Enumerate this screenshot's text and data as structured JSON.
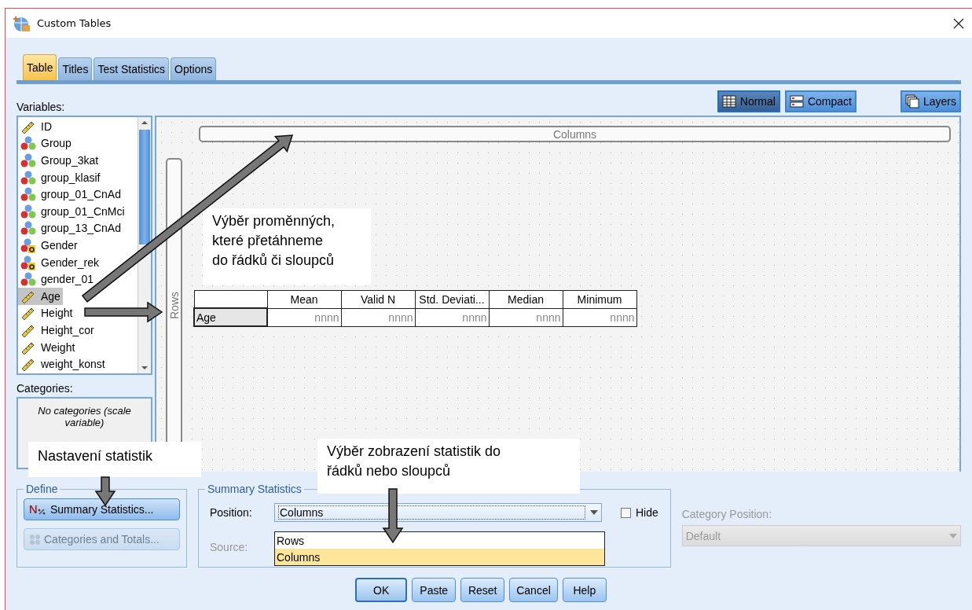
{
  "window": {
    "title": "Custom Tables"
  },
  "tabs": [
    {
      "label": "Table",
      "selected": true
    },
    {
      "label": "Titles",
      "selected": false
    },
    {
      "label": "Test Statistics",
      "selected": false
    },
    {
      "label": "Options",
      "selected": false
    }
  ],
  "variables_label": "Variables:",
  "view_buttons": [
    {
      "label": "Normal",
      "kind": "normal",
      "selected": true
    },
    {
      "label": "Compact",
      "kind": "compact",
      "selected": false
    }
  ],
  "layers_button": "Layers",
  "variables": [
    {
      "name": "ID",
      "kind": "scale",
      "selected": false
    },
    {
      "name": "Group",
      "kind": "nominal",
      "selected": false
    },
    {
      "name": "Group_3kat",
      "kind": "nominal",
      "selected": false
    },
    {
      "name": "group_klasif",
      "kind": "nominal",
      "selected": false
    },
    {
      "name": "group_01_CnAd",
      "kind": "nominal",
      "selected": false
    },
    {
      "name": "group_01_CnMci",
      "kind": "nominal",
      "selected": false
    },
    {
      "name": "group_13_CnAd",
      "kind": "nominal",
      "selected": false
    },
    {
      "name": "Gender",
      "kind": "nominal_string",
      "selected": false
    },
    {
      "name": "Gender_rek",
      "kind": "nominal_string",
      "selected": false
    },
    {
      "name": "gender_01",
      "kind": "nominal",
      "selected": false
    },
    {
      "name": "Age",
      "kind": "scale",
      "selected": true
    },
    {
      "name": "Height",
      "kind": "scale",
      "selected": false
    },
    {
      "name": "Height_cor",
      "kind": "scale",
      "selected": false
    },
    {
      "name": "Weight",
      "kind": "scale",
      "selected": false
    },
    {
      "name": "weight_konst",
      "kind": "scale",
      "selected": false
    }
  ],
  "categories": {
    "label": "Categories:",
    "message": "No categories (scale variable)"
  },
  "canvas": {
    "columns_label": "Columns",
    "rows_label": "Rows",
    "table": {
      "columns": [
        "Mean",
        "Valid N",
        "Std. Deviati...",
        "Median",
        "Minimum"
      ],
      "rows": [
        {
          "label": "Age",
          "cells": [
            "nnnn",
            "nnnn",
            "nnnn",
            "nnnn",
            "nnnn"
          ]
        }
      ]
    }
  },
  "define": {
    "legend": "Define",
    "buttons": [
      {
        "label": "Summary Statistics...",
        "kind": "summary",
        "disabled": false
      },
      {
        "label": "Categories and Totals...",
        "kind": "categories",
        "disabled": true
      }
    ]
  },
  "summary_statistics": {
    "legend": "Summary Statistics",
    "position": {
      "label": "Position:",
      "value": "Columns",
      "expanded": true,
      "options": [
        {
          "label": "Rows",
          "selected": false
        },
        {
          "label": "Columns",
          "selected": true
        }
      ]
    },
    "hide": {
      "label": "Hide",
      "checked": false
    },
    "source": {
      "label": "Source:",
      "disabled": true
    }
  },
  "category_position": {
    "label": "Category Position:",
    "value": "Default",
    "disabled": true
  },
  "buttons": [
    {
      "label": "OK",
      "default": true
    },
    {
      "label": "Paste",
      "default": false
    },
    {
      "label": "Reset",
      "default": false
    },
    {
      "label": "Cancel",
      "default": false
    },
    {
      "label": "Help",
      "default": false
    }
  ],
  "annotations": [
    {
      "lines": [
        "Výběr proměnných,",
        "které přetáhneme",
        "do řádků či sloupců"
      ]
    },
    {
      "lines": [
        "Nastavení statistik"
      ]
    },
    {
      "lines": [
        "Výběr zobrazení statistik do",
        "řádků nebo sloupců"
      ]
    }
  ]
}
